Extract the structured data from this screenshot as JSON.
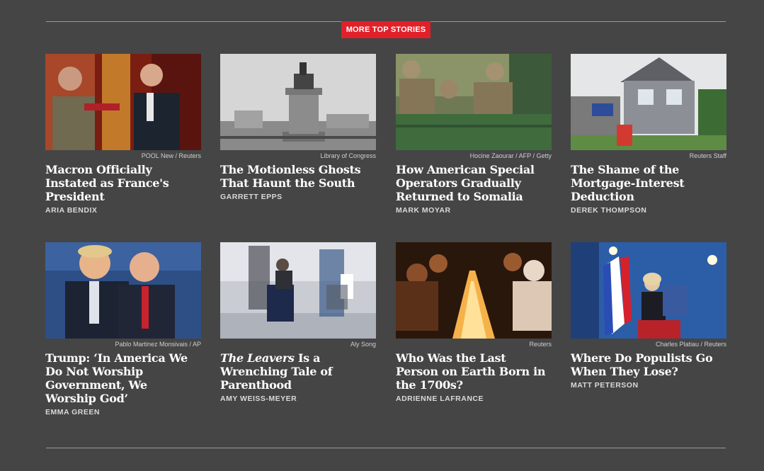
{
  "section": {
    "label": "MORE TOP STORIES"
  },
  "stories": [
    {
      "credit": "POOL New / Reuters",
      "headline": "Macron Officially Instated as France's President",
      "author": "ARIA BENDIX",
      "image": "macron-inauguration-photo"
    },
    {
      "credit": "Library of Congress",
      "headline": "The Motionless Ghosts That Haunt the South",
      "author": "GARRETT EPPS",
      "image": "equestrian-statue-photo"
    },
    {
      "credit": "Hocine Zaourar / AFP / Getty",
      "headline": "How American Special Operators Gradually Returned to Somalia",
      "author": "MARK MOYAR",
      "image": "soldiers-truck-photo"
    },
    {
      "credit": "Reuters Staff",
      "headline": "The Shame of the Mortgage-Interest Deduction",
      "author": "DEREK THOMPSON",
      "image": "house-for-sale-photo"
    },
    {
      "credit": "Pablo Martinez Monsivais / AP",
      "headline": "Trump: ‘In America We Do Not Worship Government, We Worship God’",
      "author": "EMMA GREEN",
      "image": "trump-falwell-photo"
    },
    {
      "credit": "Aly Song",
      "headline_em": "The Leavers",
      "headline": " Is a Wrenching Tale of Parenthood",
      "author": "AMY WEISS-MEYER",
      "image": "airport-child-suitcase-photo"
    },
    {
      "credit": "Reuters",
      "headline": "Who Was the Last Person on Earth Born in the 1700s?",
      "author": "ADRIENNE LAFRANCE",
      "image": "candles-vigil-photo"
    },
    {
      "credit": "Charles Platiau / Reuters",
      "headline": "Where Do Populists Go When They Lose?",
      "author": "MATT PETERSON",
      "image": "le-pen-flag-photo"
    }
  ],
  "colors": {
    "background": "#454545",
    "accent": "#e2202a",
    "text": "#ffffff"
  }
}
